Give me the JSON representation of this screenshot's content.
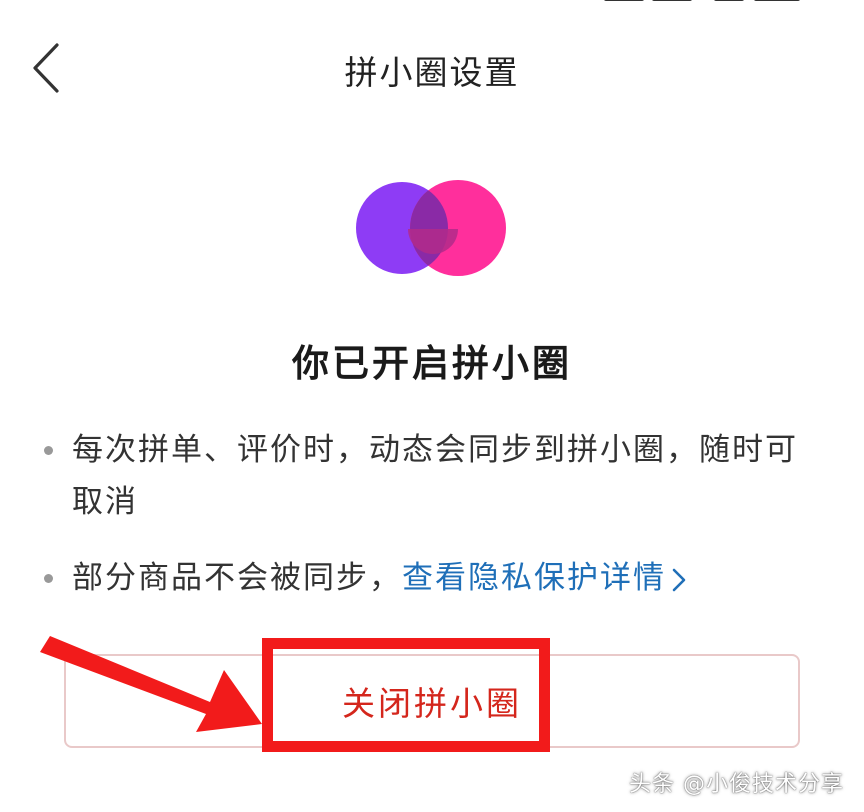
{
  "nav": {
    "title": "拼小圈设置"
  },
  "main": {
    "headline": "你已开启拼小圈",
    "bullet_1": "每次拼单、评价时，动态会同步到拼小圈，随时可取消",
    "bullet_2_prefix": "部分商品不会被同步，",
    "privacy_link": "查看隐私保护详情"
  },
  "actions": {
    "close_label": "关闭拼小圈"
  },
  "watermark": "头条 @小俊技术分享",
  "colors": {
    "accent_red": "#d4261c",
    "link_blue": "#1f6fb8",
    "logo_purple": "#8e3cf5",
    "logo_pink": "#ff2f9c",
    "annotation_red": "#f21b1b"
  },
  "icons": {
    "back": "chevron-left-icon",
    "link": "chevron-right-icon",
    "logo": "pinxiaoquan-logo"
  }
}
